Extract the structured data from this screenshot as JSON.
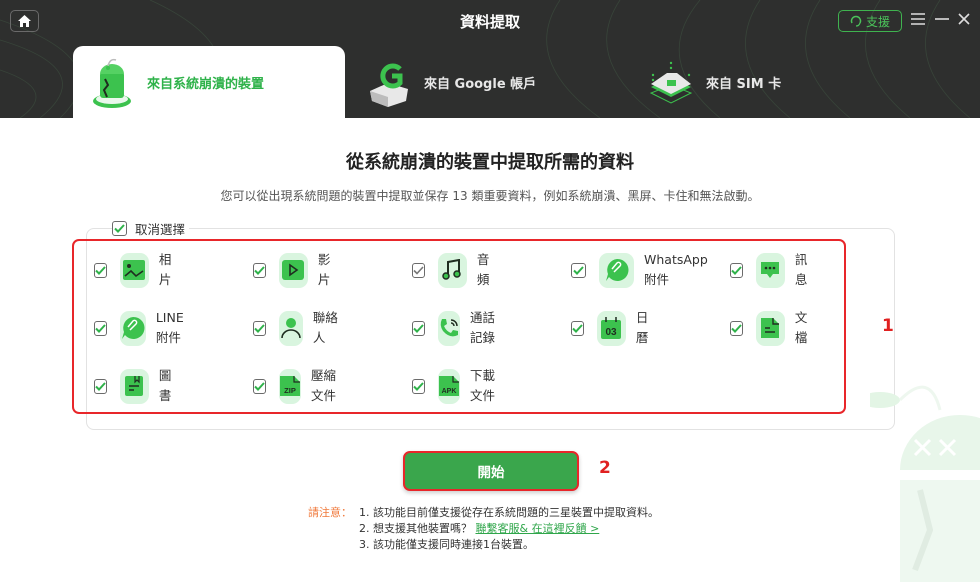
{
  "window": {
    "title": "資料提取",
    "support_label": "支援",
    "menu_icon": "hamburger-icon",
    "minimize_icon": "minimize-icon",
    "close_icon": "close-icon",
    "home_icon": "home-icon"
  },
  "tabs": [
    {
      "label": "來自系統崩潰的裝置",
      "icon": "broken-android-icon",
      "active": true
    },
    {
      "label": "來自 Google 帳戶",
      "icon": "google-account-icon",
      "active": false
    },
    {
      "label": "來自 SIM 卡",
      "icon": "sim-card-icon",
      "active": false
    }
  ],
  "main": {
    "title": "從系統崩潰的裝置中提取所需的資料",
    "subtitle": "您可以從出現系統問題的裝置中提取並保存 13 類重要資料，例如系統崩潰、黑屏、卡住和無法啟動。",
    "select_all_label": "取消選擇",
    "select_all_checked": true
  },
  "data_types": [
    {
      "label": "相片",
      "icon": "photo-icon",
      "checked": true
    },
    {
      "label": "影片",
      "icon": "video-icon",
      "checked": true
    },
    {
      "label": "音頻",
      "icon": "music-icon",
      "checked": true
    },
    {
      "label": "WhatsApp\n附件",
      "label_line1": "WhatsApp",
      "label_line2": "附件",
      "icon": "whatsapp-attachment-icon",
      "checked": true
    },
    {
      "label": "訊息",
      "icon": "message-icon",
      "checked": true
    },
    {
      "label": "LINE附件",
      "icon": "line-attachment-icon",
      "checked": true
    },
    {
      "label": "聯絡人",
      "icon": "contact-icon",
      "checked": true
    },
    {
      "label": "通話記錄",
      "icon": "call-log-icon",
      "checked": true
    },
    {
      "label": "日曆",
      "icon": "calendar-icon",
      "checked": true,
      "calendar_text": "03"
    },
    {
      "label": "文檔",
      "icon": "document-icon",
      "checked": true
    },
    {
      "label": "圖書",
      "icon": "book-icon",
      "checked": true
    },
    {
      "label": "壓縮文件",
      "icon": "zip-file-icon",
      "checked": true,
      "badge": "ZIP"
    },
    {
      "label": "下載文件",
      "icon": "apk-file-icon",
      "checked": true,
      "badge": "APK"
    }
  ],
  "annotations": {
    "one": "1",
    "two": "2"
  },
  "start_button": {
    "label": "開始"
  },
  "notes": {
    "label": "請注意：",
    "line1": "1. 該功能目前僅支援從存在系統問題的三星裝置中提取資料。",
    "line2_prefix": "2. 想支援其他裝置嗎？ ",
    "line2_link": "聯繫客服& 在這裡反饋 >",
    "line3": "3. 該功能僅支援同時連接1台裝置。"
  },
  "colors": {
    "accent": "#3aa64c",
    "header_bg": "#2e2f2e",
    "highlight": "#e8262a",
    "note_label": "#f07a3c",
    "icon_bg": "#d9f5df"
  }
}
